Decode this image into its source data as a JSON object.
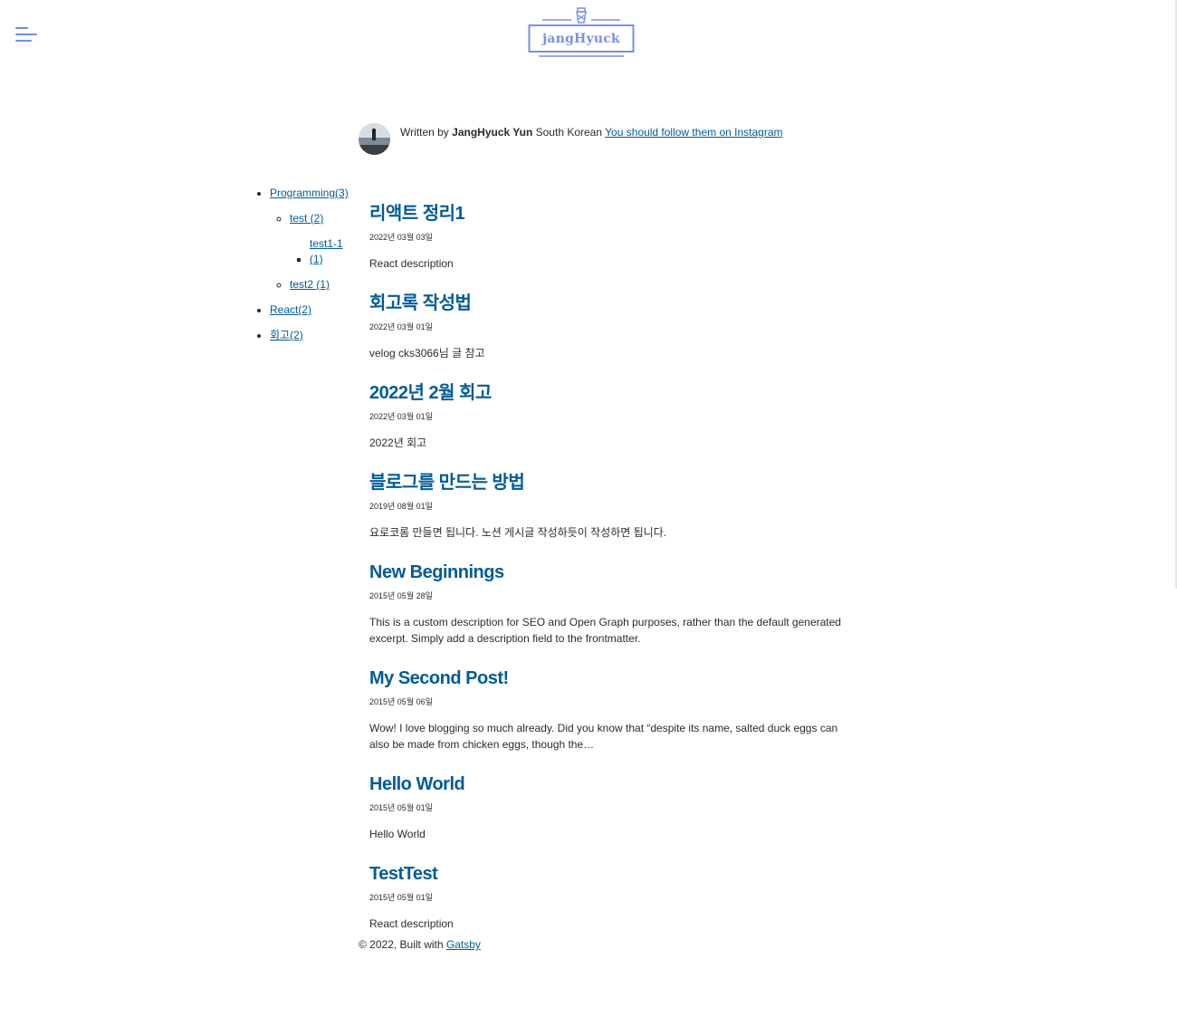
{
  "header": {
    "logo_text": "jangHyuck",
    "menu_icon": "hamburger-menu-icon",
    "logo_icon": "lighthouse-icon",
    "accent_color": "#7b8fe3"
  },
  "bio": {
    "prefix": "Written by ",
    "author": "JangHyuck Yun",
    "middle": " South Korean ",
    "link_text": "You should follow them on Instagram"
  },
  "categories": [
    {
      "label": "Programming(3)",
      "children": [
        {
          "label": "test (2)",
          "children": [
            {
              "label": "test1-1 (1)"
            }
          ]
        },
        {
          "label": "test2 (1)"
        }
      ]
    },
    {
      "label": "React(2)"
    },
    {
      "label": "회고(2)"
    }
  ],
  "posts": [
    {
      "title": "리액트 정리1",
      "date": "2022년 03월 03일",
      "description": "React description"
    },
    {
      "title": "회고록 작성법",
      "date": "2022년 03월 01일",
      "description": "velog cks3066님 글 참고"
    },
    {
      "title": "2022년 2월 회고",
      "date": "2022년 03월 01일",
      "description": "2022년 회고"
    },
    {
      "title": "블로그를 만드는 방법",
      "date": "2019년 08월 01일",
      "description": "요로코롬 만들면 됩니다. 노션 게시글 작성하듯이 작성하면 됩니다."
    },
    {
      "title": "New Beginnings",
      "date": "2015년 05월 28일",
      "description": "This is a custom description for SEO and Open Graph purposes, rather than the default generated excerpt. Simply add a description field to the frontmatter."
    },
    {
      "title": "My Second Post!",
      "date": "2015년 05월 06일",
      "description": "Wow! I love blogging so much already. Did you know that “despite its name, salted duck eggs can also be made from chicken eggs, though the…"
    },
    {
      "title": "Hello World",
      "date": "2015년 05월 01일",
      "description": "Hello World"
    },
    {
      "title": "TestTest",
      "date": "2015년 05월 01일",
      "description": "React description"
    }
  ],
  "footer": {
    "prefix": "© 2022, Built with ",
    "link_text": "Gatsby"
  }
}
